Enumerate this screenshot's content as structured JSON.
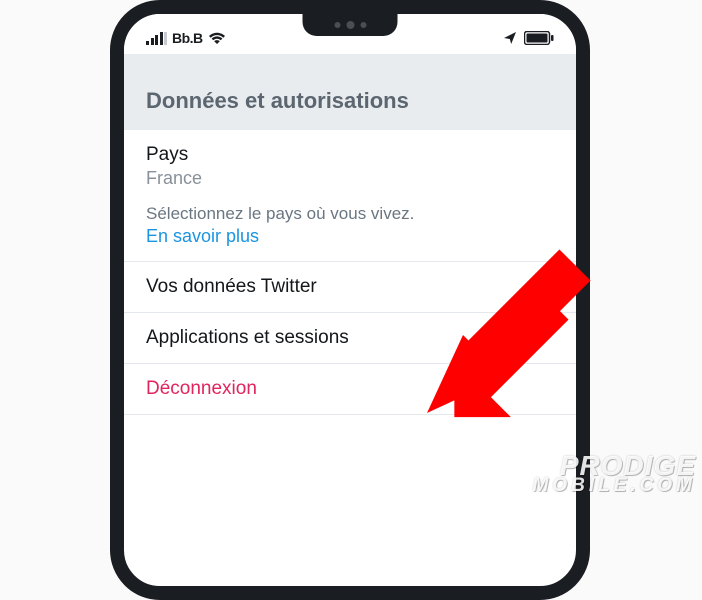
{
  "statusbar": {
    "carrier": "Bb.B"
  },
  "section": {
    "title": "Données et autorisations"
  },
  "country": {
    "label": "Pays",
    "value": "France",
    "description": "Sélectionnez le pays où vous vivez.",
    "link": "En savoir plus"
  },
  "items": [
    {
      "label": "Vos données Twitter"
    },
    {
      "label": "Applications et sessions"
    },
    {
      "label": "Déconnexion"
    }
  ],
  "watermark": {
    "line1": "PRODIGE",
    "line2": "MOBILE.COM"
  },
  "icons": {
    "signal": "signal-icon",
    "wifi": "wifi-icon",
    "location": "location-icon",
    "battery": "battery-icon",
    "arrow": "arrow-annotation"
  }
}
